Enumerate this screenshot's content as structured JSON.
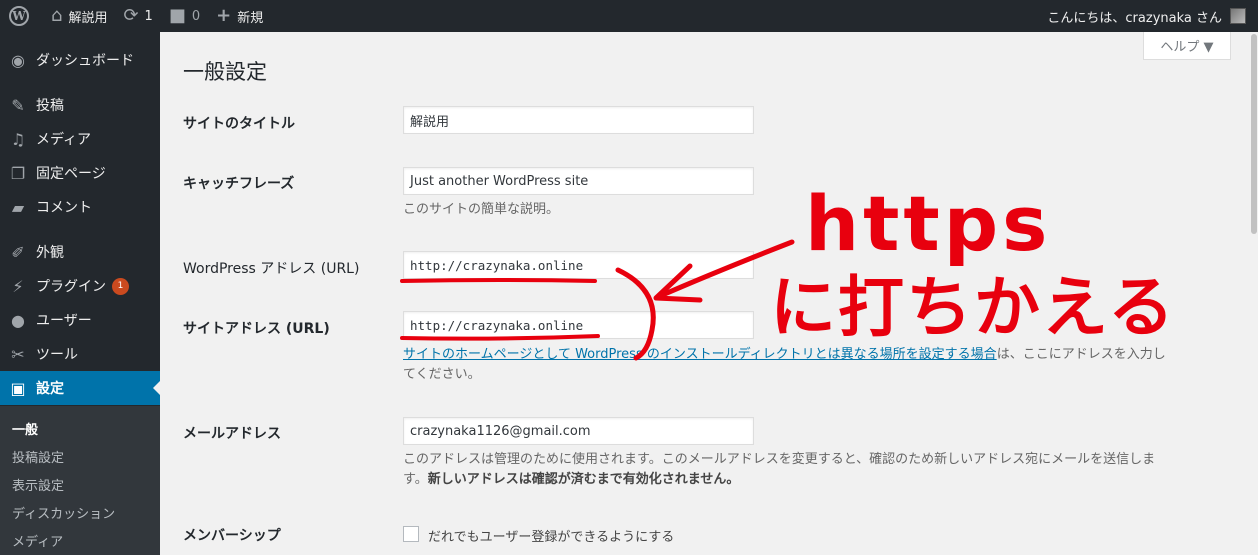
{
  "adminbar": {
    "site_name": "解説用",
    "updates_count": "1",
    "comments_count": "0",
    "new_label": "新規",
    "greeting": "こんにちは、crazynaka さん"
  },
  "sidebar": {
    "items": [
      {
        "label": "ダッシュボード",
        "icon": "dashboard-icon"
      },
      {
        "label": "投稿",
        "icon": "pin-icon"
      },
      {
        "label": "メディア",
        "icon": "media-icon"
      },
      {
        "label": "固定ページ",
        "icon": "pages-icon"
      },
      {
        "label": "コメント",
        "icon": "comment-icon"
      },
      {
        "label": "外観",
        "icon": "appearance-icon"
      },
      {
        "label": "プラグイン",
        "icon": "plugin-icon",
        "badge": "1"
      },
      {
        "label": "ユーザー",
        "icon": "user-icon"
      },
      {
        "label": "ツール",
        "icon": "wrench-icon"
      },
      {
        "label": "設定",
        "icon": "settings-icon"
      }
    ],
    "submenu": [
      "一般",
      "投稿設定",
      "表示設定",
      "ディスカッション",
      "メディア"
    ]
  },
  "main": {
    "title": "一般設定",
    "help_label": "ヘルプ ▼",
    "site_title": {
      "label": "サイトのタイトル",
      "value": "解説用"
    },
    "tagline": {
      "label": "キャッチフレーズ",
      "value": "Just another WordPress site",
      "desc": "このサイトの簡単な説明。"
    },
    "wp_url": {
      "label": "WordPress アドレス (URL)",
      "value": "http://crazynaka.online"
    },
    "site_url": {
      "label": "サイトアドレス (URL)",
      "value": "http://crazynaka.online",
      "desc_link": "サイトのホームページとして WordPress のインストールディレクトリとは異なる場所を設定する場合",
      "desc_rest1": "は、ここにアドレスを入力し",
      "desc_rest2": "てください。"
    },
    "email": {
      "label": "メールアドレス",
      "value": "crazynaka1126@gmail.com",
      "desc1": "このアドレスは管理のために使用されます。このメールアドレスを変更すると、確認のため新しいアドレス宛にメールを送信しま",
      "desc2a": "す。",
      "desc2b": "新しいアドレスは確認が済むまで有効化されません。"
    },
    "membership": {
      "label": "メンバーシップ",
      "checkbox_label": "だれでもユーザー登録ができるようにする"
    }
  },
  "annotation": {
    "line1": "https",
    "line2": "に打ちかえる",
    "color": "#e8000e"
  }
}
